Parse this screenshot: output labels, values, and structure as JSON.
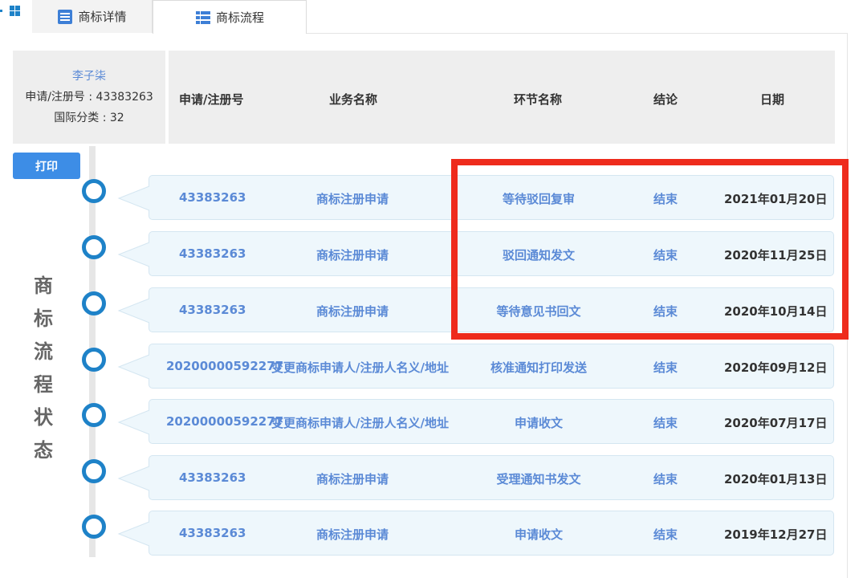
{
  "tabs": [
    {
      "label": "商标详情",
      "icon": "list-icon",
      "active": false
    },
    {
      "label": "商标流程",
      "icon": "table-icon",
      "active": true
    }
  ],
  "info": {
    "name": "李子柒",
    "reg_no": "申请/注册号 : 43383263",
    "intl_class": "国际分类 : 32"
  },
  "header": {
    "col_id": "申请/注册号",
    "col_business": "业务名称",
    "col_node": "环节名称",
    "col_result": "结论",
    "col_date": "日期"
  },
  "print_label": "打印",
  "side_label": [
    "商",
    "标",
    "流",
    "程",
    "状",
    "态"
  ],
  "rows": [
    {
      "id": "43383263",
      "business": "商标注册申请",
      "node": "等待驳回复审",
      "result": "结束",
      "date": "2021年01月20日"
    },
    {
      "id": "43383263",
      "business": "商标注册申请",
      "node": "驳回通知发文",
      "result": "结束",
      "date": "2020年11月25日"
    },
    {
      "id": "43383263",
      "business": "商标注册申请",
      "node": "等待意见书回文",
      "result": "结束",
      "date": "2020年10月14日"
    },
    {
      "id": "20200000592277",
      "business": "变更商标申请人/注册人名义/地址",
      "node": "核准通知打印发送",
      "result": "结束",
      "date": "2020年09月12日"
    },
    {
      "id": "20200000592277",
      "business": "变更商标申请人/注册人名义/地址",
      "node": "申请收文",
      "result": "结束",
      "date": "2020年07月17日"
    },
    {
      "id": "43383263",
      "business": "商标注册申请",
      "node": "受理通知书发文",
      "result": "结束",
      "date": "2020年01月13日"
    },
    {
      "id": "43383263",
      "business": "商标注册申请",
      "node": "申请收文",
      "result": "结束",
      "date": "2019年12月27日"
    }
  ],
  "colors": {
    "link_blue": "#5b8ad6",
    "timeline_blue": "#1e82c8",
    "button_blue": "#3d8de6",
    "highlight_red": "#ee2b1c",
    "row_bg": "#eef7fc"
  }
}
